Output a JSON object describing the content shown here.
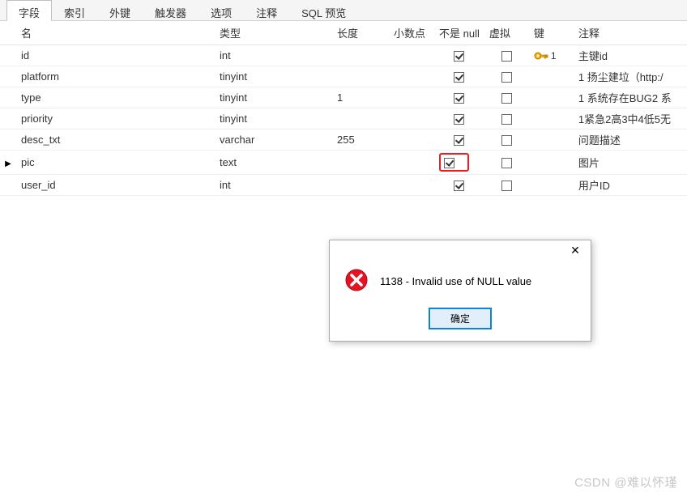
{
  "tabs": {
    "items": [
      {
        "label": "字段",
        "active": true
      },
      {
        "label": "索引",
        "active": false
      },
      {
        "label": "外键",
        "active": false
      },
      {
        "label": "触发器",
        "active": false
      },
      {
        "label": "选项",
        "active": false
      },
      {
        "label": "注释",
        "active": false
      },
      {
        "label": "SQL 预览",
        "active": false
      }
    ]
  },
  "columns": {
    "name": "名",
    "type": "类型",
    "length": "长度",
    "decimals": "小数点",
    "notnull": "不是 null",
    "virtual": "虚拟",
    "key": "键",
    "comment": "注释"
  },
  "rows": [
    {
      "marker": "",
      "name": "id",
      "type": "int",
      "length": "",
      "decimals": "",
      "notnull": true,
      "virtual": false,
      "key": true,
      "keynum": "1",
      "comment": "主键id",
      "highlight": false
    },
    {
      "marker": "",
      "name": "platform",
      "type": "tinyint",
      "length": "",
      "decimals": "",
      "notnull": true,
      "virtual": false,
      "key": false,
      "keynum": "",
      "comment": "1 扬尘建垃（http:/",
      "highlight": false
    },
    {
      "marker": "",
      "name": "type",
      "type": "tinyint",
      "length": "1",
      "decimals": "",
      "notnull": true,
      "virtual": false,
      "key": false,
      "keynum": "",
      "comment": "1 系统存在BUG2 系",
      "highlight": false
    },
    {
      "marker": "",
      "name": "priority",
      "type": "tinyint",
      "length": "",
      "decimals": "",
      "notnull": true,
      "virtual": false,
      "key": false,
      "keynum": "",
      "comment": "1紧急2高3中4低5无",
      "highlight": false
    },
    {
      "marker": "",
      "name": "desc_txt",
      "type": "varchar",
      "length": "255",
      "decimals": "",
      "notnull": true,
      "virtual": false,
      "key": false,
      "keynum": "",
      "comment": "问题描述",
      "highlight": false
    },
    {
      "marker": "▶",
      "name": "pic",
      "type": "text",
      "length": "",
      "decimals": "",
      "notnull": true,
      "virtual": false,
      "key": false,
      "keynum": "",
      "comment": "图片",
      "highlight": true
    },
    {
      "marker": "",
      "name": "user_id",
      "type": "int",
      "length": "",
      "decimals": "",
      "notnull": true,
      "virtual": false,
      "key": false,
      "keynum": "",
      "comment": "用户ID",
      "highlight": false
    }
  ],
  "dialog": {
    "message": "1138 - Invalid use of NULL value",
    "ok": "确定",
    "close": "✕"
  },
  "watermark": "CSDN @难以怀瑾"
}
